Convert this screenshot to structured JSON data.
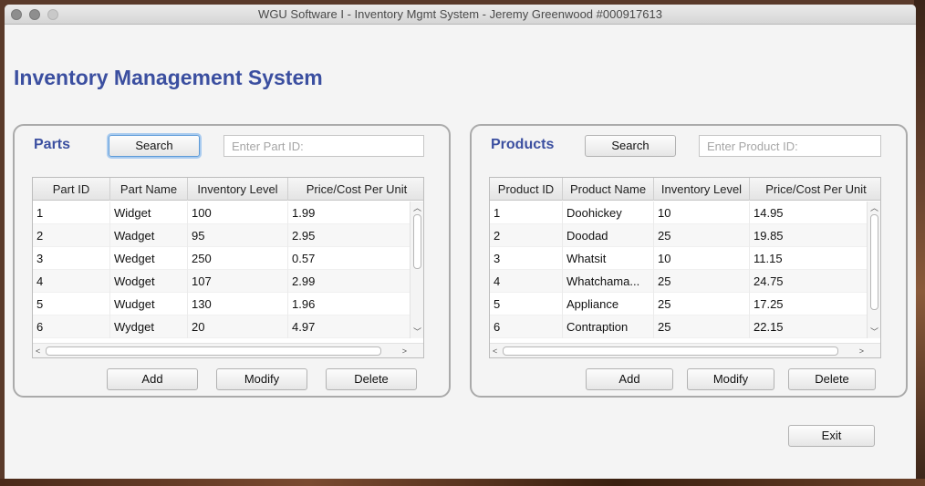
{
  "window": {
    "title": "WGU Software I - Inventory Mgmt System - Jeremy Greenwood #000917613"
  },
  "app_title": "Inventory Management System",
  "parts": {
    "title": "Parts",
    "search_label": "Search",
    "search_placeholder": "Enter Part ID:",
    "columns": [
      "Part ID",
      "Part Name",
      "Inventory Level",
      "Price/Cost Per Unit"
    ],
    "rows": [
      [
        "1",
        "Widget",
        "100",
        "1.99"
      ],
      [
        "2",
        "Wadget",
        "95",
        "2.95"
      ],
      [
        "3",
        "Wedget",
        "250",
        "0.57"
      ],
      [
        "4",
        "Wodget",
        "107",
        "2.99"
      ],
      [
        "5",
        "Wudget",
        "130",
        "1.96"
      ],
      [
        "6",
        "Wydget",
        "20",
        "4.97"
      ]
    ],
    "add_label": "Add",
    "modify_label": "Modify",
    "delete_label": "Delete"
  },
  "products": {
    "title": "Products",
    "search_label": "Search",
    "search_placeholder": "Enter Product ID:",
    "columns": [
      "Product ID",
      "Product Name",
      "Inventory Level",
      "Price/Cost Per Unit"
    ],
    "rows": [
      [
        "1",
        "Doohickey",
        "10",
        "14.95"
      ],
      [
        "2",
        "Doodad",
        "25",
        "19.85"
      ],
      [
        "3",
        "Whatsit",
        "10",
        "11.15"
      ],
      [
        "4",
        "Whatchama...",
        "25",
        "24.75"
      ],
      [
        "5",
        "Appliance",
        "25",
        "17.25"
      ],
      [
        "6",
        "Contraption",
        "25",
        "22.15"
      ]
    ],
    "add_label": "Add",
    "modify_label": "Modify",
    "delete_label": "Delete"
  },
  "exit_label": "Exit",
  "colors": {
    "accent": "#3b4fa0",
    "focus": "#5d9bd8"
  }
}
